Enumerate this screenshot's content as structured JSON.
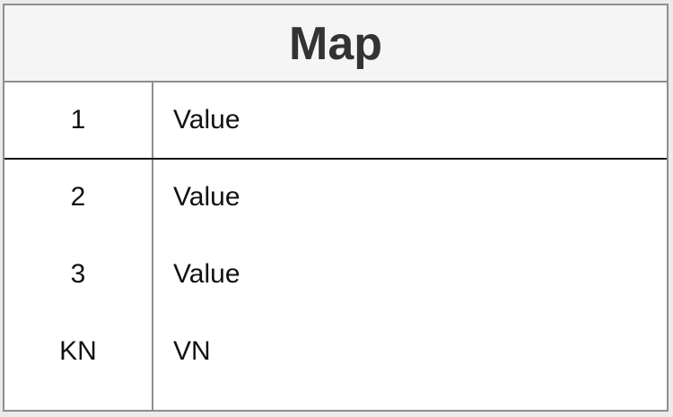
{
  "map": {
    "title": "Map",
    "rows": [
      {
        "key": "1",
        "value": "Value"
      },
      {
        "key": "2",
        "value": "Value"
      },
      {
        "key": "3",
        "value": "Value"
      },
      {
        "key": "KN",
        "value": "VN"
      }
    ]
  },
  "colors": {
    "border": "#8e8e8e",
    "header_bg": "#f5f5f5",
    "title_text": "#333333",
    "row_separator": "#111111"
  }
}
